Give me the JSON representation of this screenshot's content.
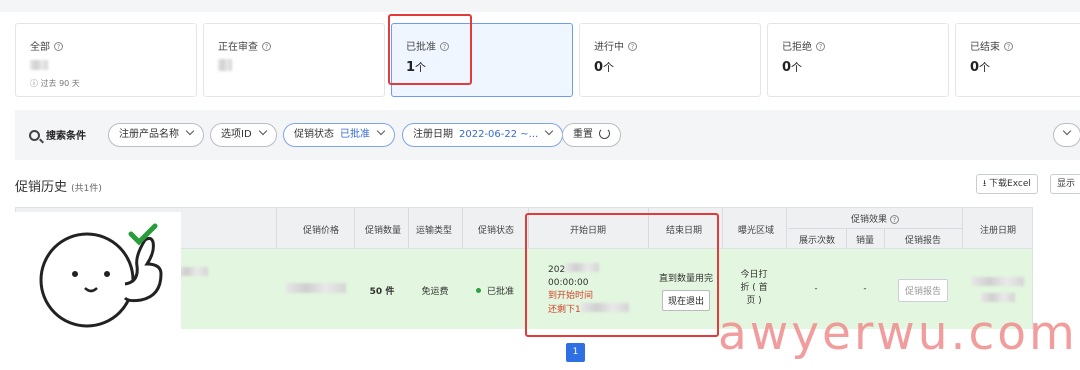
{
  "cards": [
    {
      "label": "全部",
      "count": "",
      "sub": "过去 90 天"
    },
    {
      "label": "正在审查",
      "count": ""
    },
    {
      "label": "已批准",
      "count": "1",
      "unit": "个"
    },
    {
      "label": "进行中",
      "count": "0",
      "unit": "个"
    },
    {
      "label": "已拒绝",
      "count": "0",
      "unit": "个"
    },
    {
      "label": "已结束",
      "count": "0",
      "unit": "个"
    }
  ],
  "filters": {
    "search_label": "搜索条件",
    "product_name": "注册产品名称",
    "option_id": "选项ID",
    "status_label": "促销状态",
    "status_value": "已批准",
    "date_label": "注册日期",
    "date_value": "2022-06-22 ~...",
    "reset": "重置"
  },
  "history": {
    "title": "促销历史",
    "count_note": "(共1件)",
    "download": "下载Excel",
    "display": "显示"
  },
  "table": {
    "headers": {
      "price": "促销价格",
      "qty": "促销数量",
      "shipping": "运输类型",
      "status": "促销状态",
      "start": "开始日期",
      "end": "结束日期",
      "exposure": "曝光区域",
      "effect": "促销效果",
      "views": "展示次数",
      "sales": "销量",
      "report": "促销报告",
      "reg_date": "注册日期"
    },
    "row": {
      "qty": "50 件",
      "shipping": "免运费",
      "status": "已批准",
      "start_year": "202",
      "start_time": "00:00:00",
      "start_note": "到开始时间",
      "start_remaining": "还剩下1",
      "end_note": "直到数量用完",
      "exit_btn": "现在退出",
      "exposure_1": "今日打",
      "exposure_2": "折 ( 首",
      "exposure_3": "页 )",
      "views": "-",
      "sales": "-",
      "report_btn": "促销报告"
    }
  },
  "pagination": {
    "current": "1"
  },
  "watermark": "awyerwu.com"
}
